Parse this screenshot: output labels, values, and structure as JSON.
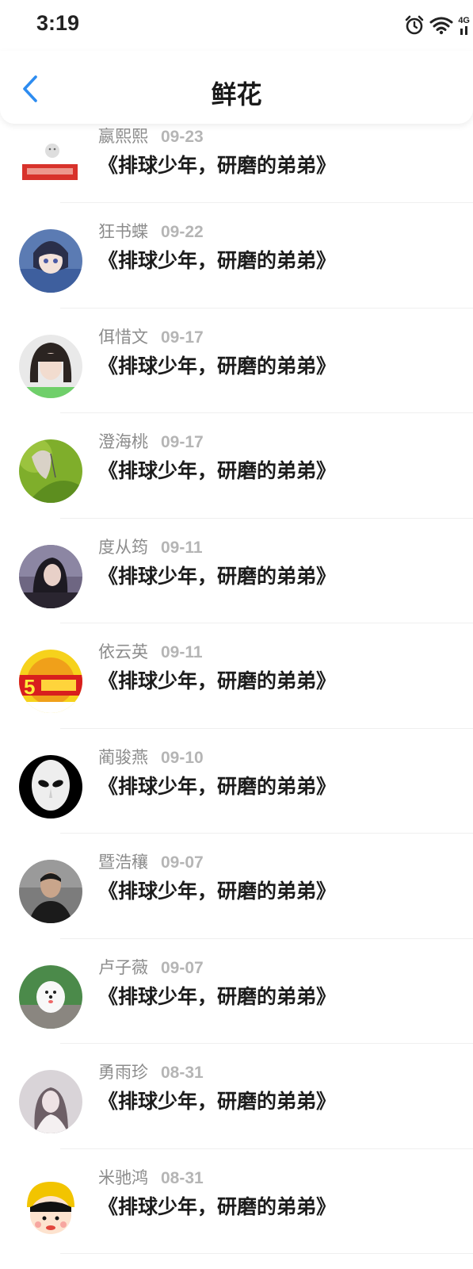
{
  "status": {
    "time": "3:19",
    "network": "4G"
  },
  "header": {
    "title": "鲜花",
    "back_icon": "chevron-left-icon"
  },
  "colors": {
    "accent": "#2d8cf0",
    "name": "#8c8c8c",
    "date": "#b5b5b5",
    "text": "#1c1c1c"
  },
  "items": [
    {
      "name": "嬴熙熙",
      "date": "09-23",
      "book": "《排球少年，研磨的弟弟》"
    },
    {
      "name": "狂书蝶",
      "date": "09-22",
      "book": "《排球少年，研磨的弟弟》"
    },
    {
      "name": "佴惜文",
      "date": "09-17",
      "book": "《排球少年，研磨的弟弟》"
    },
    {
      "name": "澄海桃",
      "date": "09-17",
      "book": "《排球少年，研磨的弟弟》"
    },
    {
      "name": "度从筠",
      "date": "09-11",
      "book": "《排球少年，研磨的弟弟》"
    },
    {
      "name": "依云英",
      "date": "09-11",
      "book": "《排球少年，研磨的弟弟》"
    },
    {
      "name": "蔺骏燕",
      "date": "09-10",
      "book": "《排球少年，研磨的弟弟》"
    },
    {
      "name": "暨浩穰",
      "date": "09-07",
      "book": "《排球少年，研磨的弟弟》"
    },
    {
      "name": "卢子薇",
      "date": "09-07",
      "book": "《排球少年，研磨的弟弟》"
    },
    {
      "name": "勇雨珍",
      "date": "08-31",
      "book": "《排球少年，研磨的弟弟》"
    },
    {
      "name": "米驰鸿",
      "date": "08-31",
      "book": "《排球少年，研磨的弟弟》"
    }
  ]
}
